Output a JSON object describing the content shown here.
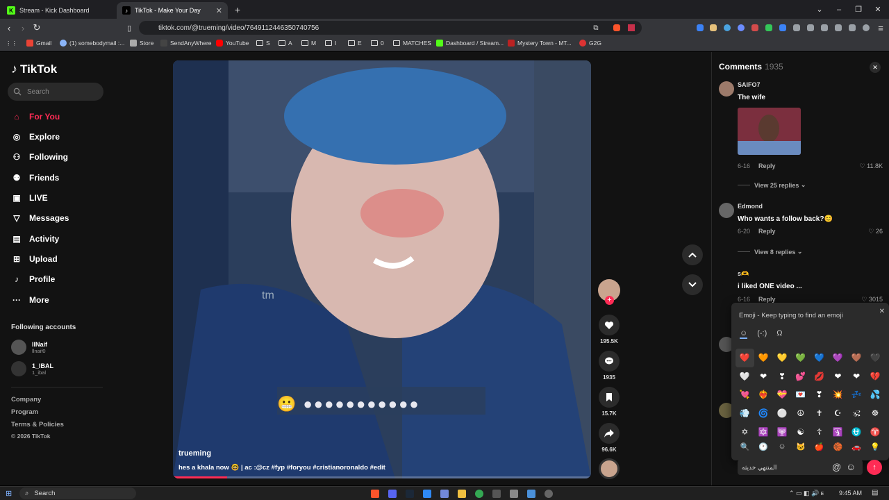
{
  "browser": {
    "tabs": [
      {
        "title": "Stream - Kick Dashboard",
        "fav": "K"
      },
      {
        "title": "TikTok - Make Your Day",
        "fav": "♪"
      }
    ],
    "url": "tiktok.com/@trueming/video/7649112446350740756",
    "bookmarks": [
      "Gmail",
      "(1) somebodymail :...",
      "Store",
      "SendAnyWhere",
      "YouTube",
      "S",
      "A",
      "M",
      "I",
      "E",
      "0",
      "MATCHES",
      "Dashboard / Stream...",
      "Mystery Town - MT...",
      "G2G"
    ]
  },
  "sidebar": {
    "logo": "TikTok",
    "search_placeholder": "Search",
    "nav": [
      {
        "label": "For You",
        "icon": "home-icon"
      },
      {
        "label": "Explore",
        "icon": "compass-icon"
      },
      {
        "label": "Following",
        "icon": "following-icon"
      },
      {
        "label": "Friends",
        "icon": "friends-icon"
      },
      {
        "label": "LIVE",
        "icon": "live-icon"
      },
      {
        "label": "Messages",
        "icon": "messages-icon"
      },
      {
        "label": "Activity",
        "icon": "activity-icon"
      },
      {
        "label": "Upload",
        "icon": "upload-icon"
      },
      {
        "label": "Profile",
        "icon": "profile-icon"
      },
      {
        "label": "More",
        "icon": "more-icon"
      }
    ],
    "following_title": "Following accounts",
    "following": [
      {
        "name": "IINaif",
        "handle": "llnaif0"
      },
      {
        "name": "1_IBAL",
        "handle": "1_ibal"
      }
    ],
    "footer": [
      "Company",
      "Program",
      "Terms & Policies",
      "© 2026 TikTok"
    ]
  },
  "video": {
    "username": "trueming",
    "caption": "hes a khala now 🤓 | ac :@cz #fyp #foryou #cristianoronaldo #edit",
    "watermark": "tm",
    "overlay_text": "😬 ●●●●●●●●●●●",
    "progress": 0.13
  },
  "actions": {
    "likes": "195.5K",
    "comments": "1935",
    "saves": "15.7K",
    "shares": "96.6K"
  },
  "comments": {
    "title": "Comments",
    "count": "1935",
    "items": [
      {
        "user": "SAIFO7",
        "text": "The wife",
        "date": "6-16",
        "reply": "Reply",
        "likes": "11.8K",
        "view": "View 25 replies"
      },
      {
        "user": "Edmond",
        "text": "Who wants a follow back?😊",
        "date": "6-20",
        "reply": "Reply",
        "likes": "26",
        "view": "View 8 replies"
      },
      {
        "user": "s🫶",
        "text": "i liked ONE video ...",
        "date": "6-16",
        "reply": "Reply",
        "likes": "3015"
      }
    ],
    "input_value": "المنتهي خديثه",
    "post_label": "↑"
  },
  "emoji_picker": {
    "title": "Emoji - Keep typing to find an emoji",
    "tabs": [
      "☺",
      "(-:)",
      "Ω"
    ],
    "emojis": [
      "❤️",
      "🧡",
      "💛",
      "💚",
      "💙",
      "💜",
      "🤎",
      "🖤",
      "🤍",
      "❤",
      "❣",
      "💕",
      "💋",
      "❤",
      "❤",
      "💔",
      "💘",
      "❤‍🔥",
      "💝",
      "💌",
      "❣",
      "💥",
      "💤",
      "💦",
      "💨",
      "🌀",
      "⚪",
      "☮",
      "✝",
      "☪",
      "🕉",
      "☸",
      "✡",
      "🔯",
      "🕎",
      "☯",
      "☦",
      "🛐",
      "⛎",
      "♈"
    ],
    "cats": [
      "🔍",
      "🕐",
      "☺",
      "🐱",
      "🍎",
      "🏀",
      "🚗",
      "💡"
    ]
  },
  "taskbar": {
    "search": "Search",
    "time": "9:45 AM"
  }
}
